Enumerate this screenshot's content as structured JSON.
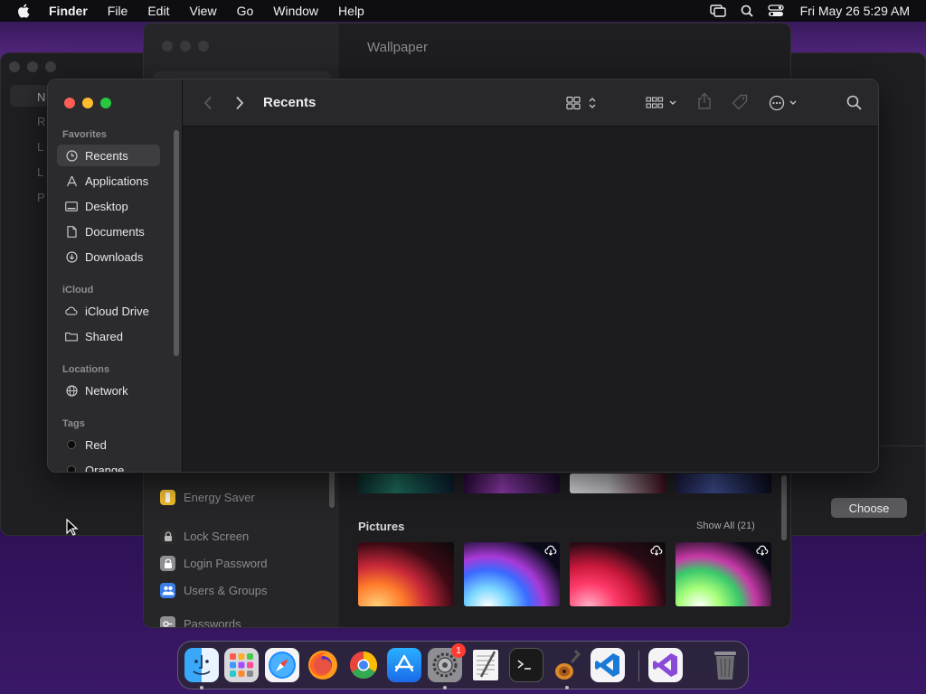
{
  "menubar": {
    "app_name": "Finder",
    "items": [
      "File",
      "Edit",
      "View",
      "Go",
      "Window",
      "Help"
    ],
    "clock": "Fri May 26  5:29 AM",
    "icons": [
      "apple-icon",
      "screen-mirroring-icon",
      "spotlight-search-icon",
      "control-center-icon"
    ]
  },
  "background_window": {
    "sidebar_letters": [
      "N",
      "R",
      "L",
      "L",
      "P"
    ],
    "choose_label": "Choose"
  },
  "settings": {
    "title": "Wallpaper",
    "sidebar_items": [
      {
        "label": "Energy Saver",
        "icon": "energy-saver-icon",
        "color": "#f5c030"
      },
      {
        "label": "Lock Screen",
        "icon": "lock-icon",
        "color": "#2a2a2a"
      },
      {
        "label": "Login Password",
        "icon": "password-icon",
        "color": "#8e8e93"
      },
      {
        "label": "Users & Groups",
        "icon": "users-icon",
        "color": "#3a7ee8"
      },
      {
        "label": "Passwords",
        "icon": "key-icon",
        "color": "#8e8e93"
      }
    ],
    "pictures": {
      "heading": "Pictures",
      "show_all": "Show All (21)"
    }
  },
  "finder": {
    "title": "Recents",
    "sidebar": {
      "favorites_label": "Favorites",
      "favorites": [
        {
          "label": "Recents",
          "icon": "clock-icon"
        },
        {
          "label": "Applications",
          "icon": "applications-icon"
        },
        {
          "label": "Desktop",
          "icon": "desktop-icon"
        },
        {
          "label": "Documents",
          "icon": "document-icon"
        },
        {
          "label": "Downloads",
          "icon": "download-icon"
        }
      ],
      "icloud_label": "iCloud",
      "icloud": [
        {
          "label": "iCloud Drive",
          "icon": "cloud-icon"
        },
        {
          "label": "Shared",
          "icon": "shared-folder-icon"
        }
      ],
      "locations_label": "Locations",
      "locations": [
        {
          "label": "Network",
          "icon": "globe-icon"
        }
      ],
      "tags_label": "Tags",
      "tags": [
        {
          "label": "Red"
        },
        {
          "label": "Orange"
        }
      ]
    },
    "toolbar_icons": [
      "back-icon",
      "forward-icon",
      "icon-view-icon",
      "group-icon",
      "share-icon",
      "tag-icon",
      "more-icon",
      "search-icon"
    ]
  },
  "dock": {
    "apps": [
      "Finder",
      "Launchpad",
      "Safari",
      "Firefox",
      "Chrome",
      "App Store",
      "System Settings",
      "TextEdit",
      "Terminal",
      "Instruments",
      "Visual Studio Code",
      "Visual Studio",
      "Trash"
    ],
    "settings_badge": "1"
  }
}
